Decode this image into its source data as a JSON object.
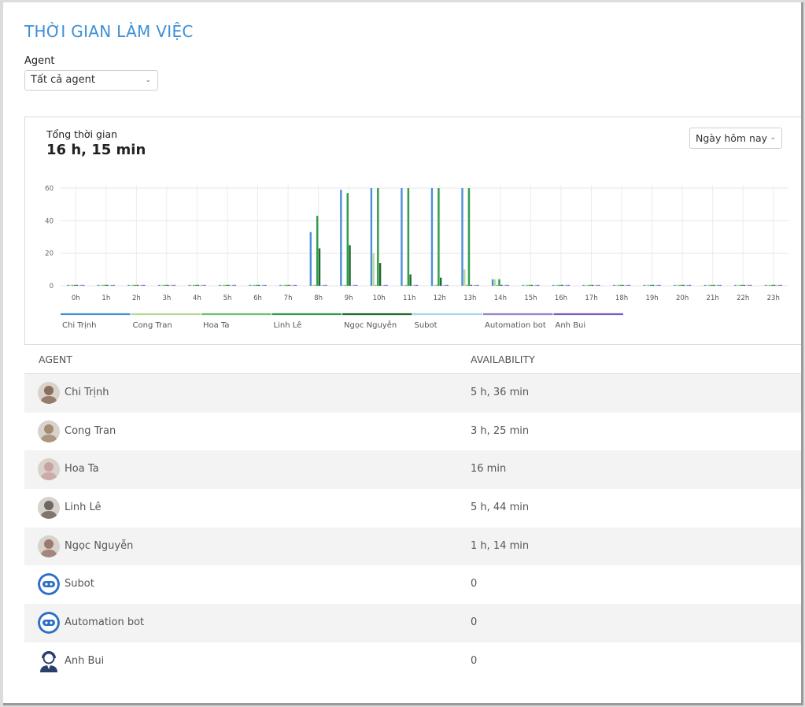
{
  "page": {
    "title": "THỜI GIAN LÀM VIỆC"
  },
  "filter": {
    "agent_label": "Agent",
    "agent_value": "Tất cả agent"
  },
  "summary": {
    "subtitle": "Tổng thời gian",
    "total": "16 h, 15 min",
    "range_value": "Ngày hôm nay"
  },
  "icons": {
    "dropdown": "chevron-down-icon"
  },
  "chart_data": {
    "type": "bar",
    "categories": [
      "0h",
      "1h",
      "2h",
      "3h",
      "4h",
      "5h",
      "6h",
      "7h",
      "8h",
      "9h",
      "10h",
      "11h",
      "12h",
      "13h",
      "14h",
      "15h",
      "16h",
      "17h",
      "18h",
      "19h",
      "20h",
      "21h",
      "22h",
      "23h"
    ],
    "ylim": [
      0,
      60
    ],
    "yticks": [
      0,
      20,
      40,
      60
    ],
    "grid": true,
    "legend_position": "bottom",
    "series": [
      {
        "name": "Chi Trịnh",
        "color": "#4a90d9",
        "values": [
          0,
          0,
          0,
          0,
          0,
          0,
          0,
          0,
          33,
          59,
          60,
          60,
          60,
          60,
          4,
          0,
          0,
          0,
          0,
          0,
          0,
          0,
          0,
          0
        ]
      },
      {
        "name": "Cong Tran",
        "color": "#b8d99a",
        "values": [
          0,
          0,
          0,
          0,
          0,
          0,
          0,
          0,
          0,
          0,
          20,
          0,
          0,
          10,
          4,
          0,
          0,
          0,
          0,
          0,
          0,
          0,
          0,
          0
        ]
      },
      {
        "name": "Hoa Ta",
        "color": "#6cc16c",
        "values": [
          0,
          0,
          0,
          0,
          0,
          0,
          0,
          0,
          0,
          0,
          0,
          0,
          0,
          0,
          0,
          0,
          0,
          0,
          0,
          0,
          0,
          0,
          0,
          0
        ]
      },
      {
        "name": "Linh Lê",
        "color": "#2e9e4a",
        "values": [
          0,
          0,
          0,
          0,
          0,
          0,
          0,
          0,
          43,
          57,
          60,
          60,
          60,
          60,
          4,
          0,
          0,
          0,
          0,
          0,
          0,
          0,
          0,
          0
        ]
      },
      {
        "name": "Ngọc Nguyễn",
        "color": "#1e6b2e",
        "values": [
          0,
          0,
          0,
          0,
          0,
          0,
          0,
          0,
          23,
          25,
          14,
          7,
          5,
          0,
          0,
          0,
          0,
          0,
          0,
          0,
          0,
          0,
          0,
          0
        ]
      },
      {
        "name": "Subot",
        "color": "#a9d6f0",
        "values": [
          0,
          0,
          0,
          0,
          0,
          0,
          0,
          0,
          0,
          0,
          0,
          0,
          0,
          0,
          0,
          0,
          0,
          0,
          0,
          0,
          0,
          0,
          0,
          0
        ]
      },
      {
        "name": "Automation bot",
        "color": "#9b7fd1",
        "values": [
          0,
          0,
          0,
          0,
          0,
          0,
          0,
          0,
          0,
          0,
          0,
          0,
          0,
          0,
          0,
          0,
          0,
          0,
          0,
          0,
          0,
          0,
          0,
          0
        ]
      },
      {
        "name": "Anh Bui",
        "color": "#7b5cc4",
        "values": [
          0,
          0,
          0,
          0,
          0,
          0,
          0,
          0,
          0,
          0,
          0,
          0,
          0,
          0,
          0,
          0,
          0,
          0,
          0,
          0,
          0,
          0,
          0,
          0
        ]
      }
    ]
  },
  "table": {
    "headers": {
      "agent": "AGENT",
      "availability": "AVAILABILITY"
    },
    "rows": [
      {
        "name": "Chi Trịnh",
        "availability": "5 h, 36 min",
        "avatar": "user-photo-avatar"
      },
      {
        "name": "Cong Tran",
        "availability": "3 h, 25 min",
        "avatar": "user-photo-avatar"
      },
      {
        "name": "Hoa Ta",
        "availability": "16 min",
        "avatar": "user-photo-avatar"
      },
      {
        "name": "Linh Lê",
        "availability": "5 h, 44 min",
        "avatar": "user-photo-avatar"
      },
      {
        "name": "Ngọc Nguyễn",
        "availability": "1 h, 14 min",
        "avatar": "user-photo-avatar"
      },
      {
        "name": "Subot",
        "availability": "0",
        "avatar": "bot-icon"
      },
      {
        "name": "Automation bot",
        "availability": "0",
        "avatar": "bot-icon"
      },
      {
        "name": "Anh Bui",
        "availability": "0",
        "avatar": "support-agent-icon"
      }
    ]
  }
}
